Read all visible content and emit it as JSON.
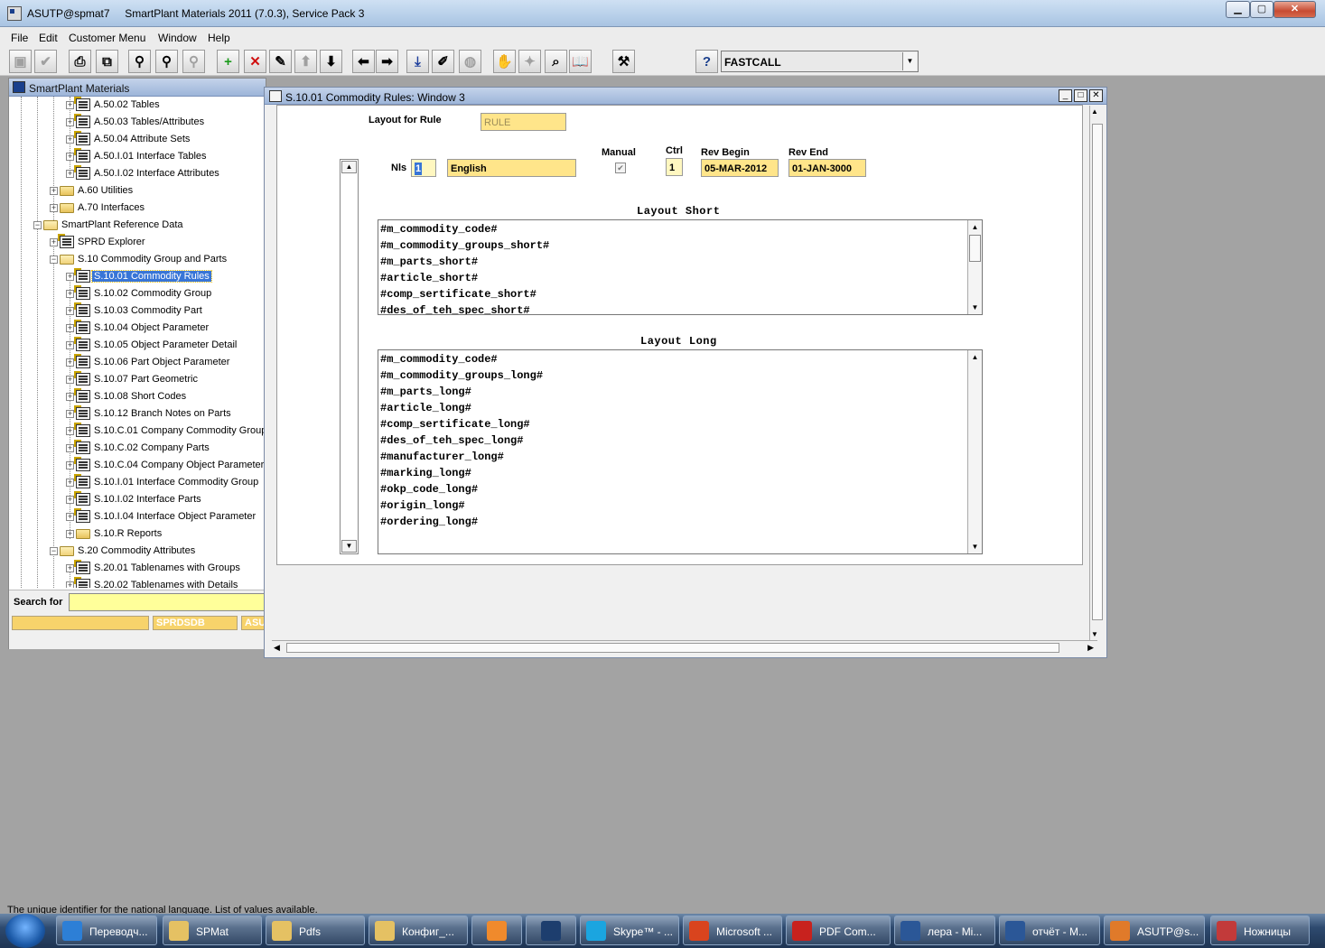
{
  "window": {
    "title": "ASUTP@spmat7     SmartPlant Materials 2011 (7.0.3), Service Pack 3",
    "min": "▁",
    "max": "▢",
    "close": "✕"
  },
  "menu": [
    "File",
    "Edit",
    "Customer Menu",
    "Window",
    "Help"
  ],
  "toolbar": {
    "fastcall_value": "FASTCALL",
    "help_label": "?"
  },
  "navigator": {
    "title": "SmartPlant Materials",
    "items": [
      {
        "label": "A.50.02 Tables",
        "type": "form"
      },
      {
        "label": "A.50.03 Tables/Attributes",
        "type": "form"
      },
      {
        "label": "A.50.04 Attribute Sets",
        "type": "form"
      },
      {
        "label": "A.50.I.01 Interface Tables",
        "type": "form"
      },
      {
        "label": "A.50.I.02 Interface Attributes",
        "type": "form"
      },
      {
        "label": "A.60 Utilities",
        "type": "folder"
      },
      {
        "label": "A.70 Interfaces",
        "type": "folder"
      },
      {
        "label": "SmartPlant Reference Data",
        "type": "folder-open"
      },
      {
        "label": "SPRD Explorer",
        "type": "form"
      },
      {
        "label": "S.10 Commodity Group and Parts",
        "type": "folder-open"
      },
      {
        "label": "S.10.01 Commodity Rules",
        "type": "form",
        "selected": true
      },
      {
        "label": "S.10.02 Commodity Group",
        "type": "form"
      },
      {
        "label": "S.10.03 Commodity Part",
        "type": "form"
      },
      {
        "label": "S.10.04 Object Parameter",
        "type": "form"
      },
      {
        "label": "S.10.05 Object Parameter Detail",
        "type": "form"
      },
      {
        "label": "S.10.06 Part Object Parameter",
        "type": "form"
      },
      {
        "label": "S.10.07 Part Geometric",
        "type": "form"
      },
      {
        "label": "S.10.08 Short Codes",
        "type": "form"
      },
      {
        "label": "S.10.12 Branch Notes on Parts",
        "type": "form"
      },
      {
        "label": "S.10.C.01 Company Commodity Groups",
        "type": "form"
      },
      {
        "label": "S.10.C.02 Company Parts",
        "type": "form"
      },
      {
        "label": "S.10.C.04 Company Object Parameter",
        "type": "form"
      },
      {
        "label": "S.10.I.01 Interface Commodity Group",
        "type": "form"
      },
      {
        "label": "S.10.I.02 Interface Parts",
        "type": "form"
      },
      {
        "label": "S.10.I.04 Interface Object Parameter",
        "type": "form"
      },
      {
        "label": "S.10.R Reports",
        "type": "folder"
      },
      {
        "label": "S.20 Commodity Attributes",
        "type": "folder-open"
      },
      {
        "label": "S.20.01 Tablenames with Groups",
        "type": "form"
      },
      {
        "label": "S.20.02 Tablenames with Details",
        "type": "form"
      }
    ],
    "search_label": "Search for",
    "search_value": "",
    "status_fields": [
      "",
      "SPRDSDB",
      "ASU"
    ]
  },
  "form": {
    "title": "S.10.01 Commodity Rules: Window 3",
    "layout_for_rule_label": "Layout for Rule",
    "layout_for_rule_value": "RULE",
    "nls_label": "Nls",
    "nls_value": "1",
    "language_value": "English",
    "manual_label": "Manual",
    "manual_checked": true,
    "ctrl_label": "Ctrl",
    "ctrl_value": "1",
    "rev_begin_label": "Rev Begin",
    "rev_begin_value": "05-MAR-2012",
    "rev_end_label": "Rev End",
    "rev_end_value": "01-JAN-3000",
    "layout_short_label": "Layout Short",
    "layout_short_lines": [
      "#m_commodity_code#",
      "#m_commodity_groups_short#",
      "#m_parts_short#",
      "#article_short#",
      "#comp_sertificate_short#",
      "#des_of_teh_spec_short#"
    ],
    "layout_long_label": "Layout Long",
    "layout_long_lines": [
      "#m_commodity_code#",
      "#m_commodity_groups_long#",
      "#m_parts_long#",
      "#article_long#",
      "#comp_sertificate_long#",
      "#des_of_teh_spec_long#",
      "#manufacturer_long#",
      "#marking_long#",
      "#okp_code_long#",
      "#origin_long#",
      "#ordering_long#"
    ]
  },
  "statusline": "The unique identifier for the national language.  List of values available.",
  "taskbar": [
    {
      "label": "Переводч...",
      "icon": "ie-icon",
      "color": "#2d7fd6"
    },
    {
      "label": "SPMat",
      "icon": "folder-icon",
      "color": "#e5c163"
    },
    {
      "label": "Pdfs",
      "icon": "folder-icon",
      "color": "#e5c163"
    },
    {
      "label": "Конфиг_...",
      "icon": "folder-icon",
      "color": "#e5c163"
    },
    {
      "label": "",
      "icon": "media-icon",
      "color": "#f08a2c"
    },
    {
      "label": "",
      "icon": "hp-icon",
      "color": "#1d3e6e"
    },
    {
      "label": "Skype™ - ...",
      "icon": "skype-icon",
      "color": "#1ba5e0"
    },
    {
      "label": "Microsoft ...",
      "icon": "office-icon",
      "color": "#d9441e"
    },
    {
      "label": "PDF Com...",
      "icon": "pdf-icon",
      "color": "#c8221e"
    },
    {
      "label": "лера - Mi...",
      "icon": "word-icon",
      "color": "#2b5797"
    },
    {
      "label": "отчёт - M...",
      "icon": "word-icon",
      "color": "#2b5797"
    },
    {
      "label": "ASUTP@s...",
      "icon": "java-icon",
      "color": "#e07a2a"
    },
    {
      "label": "Ножницы",
      "icon": "scissors-icon",
      "color": "#c23a3a"
    }
  ]
}
